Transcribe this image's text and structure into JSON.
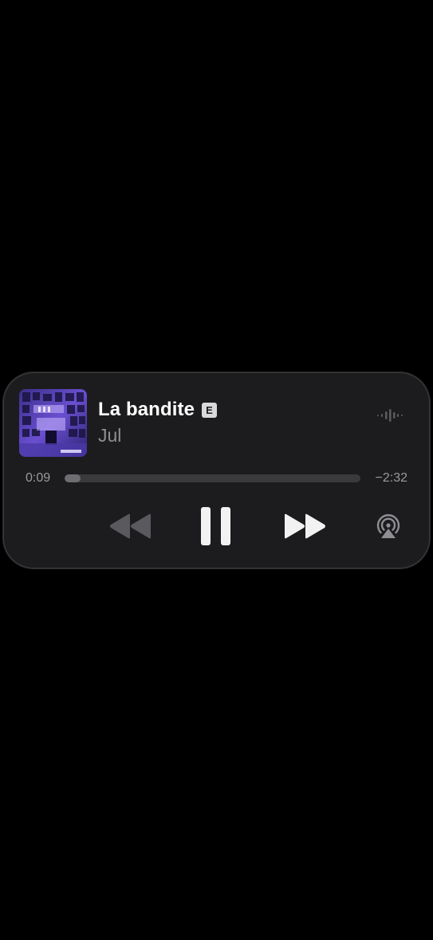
{
  "now_playing": {
    "title": "La bandite",
    "explicit_badge": "E",
    "artist": "Jul",
    "elapsed": "0:09",
    "remaining": "−2:32",
    "progress": 0.055
  },
  "icons": {
    "waveform": "waveform-icon",
    "rewind": "backward-icon",
    "pause": "pause-icon",
    "forward": "forward-icon",
    "airplay": "airplay-icon"
  },
  "colors": {
    "background": "#000000",
    "card": "#1c1c1e",
    "title": "#ffffff",
    "secondary": "#8e8e93"
  }
}
